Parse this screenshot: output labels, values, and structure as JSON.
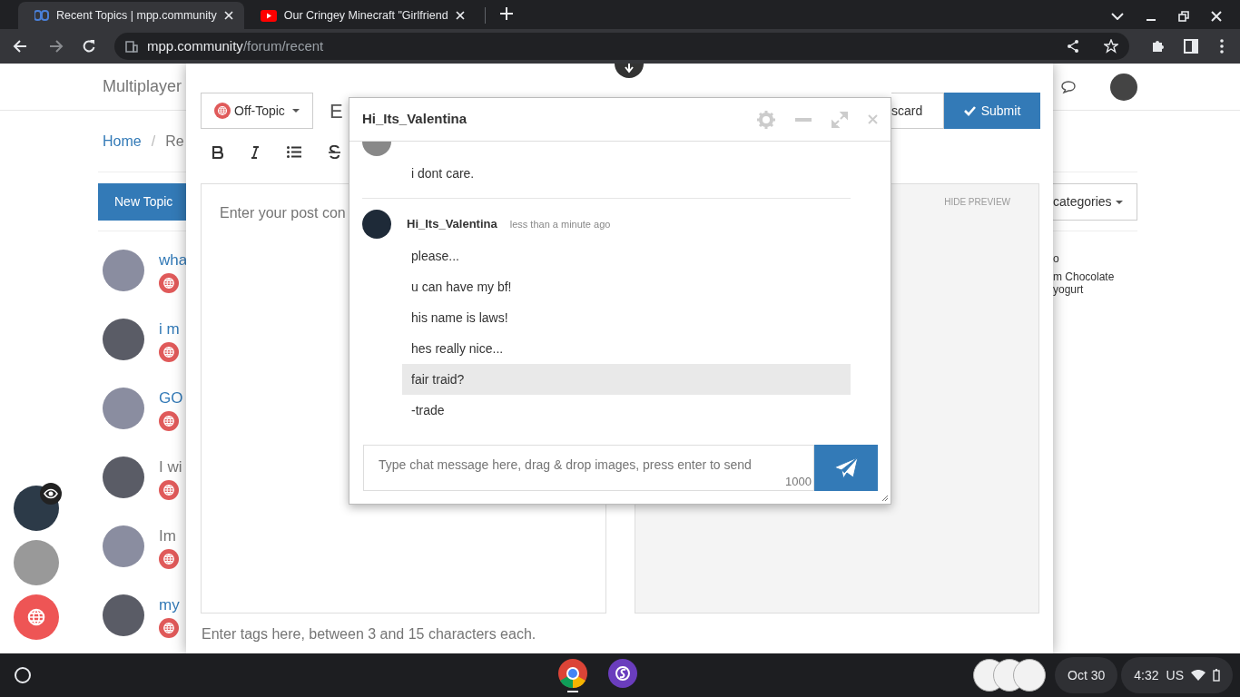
{
  "browser": {
    "tabs": [
      {
        "title": "Recent Topics | mpp.community",
        "selected": true,
        "kind": "forum"
      },
      {
        "title": "Our Cringey Minecraft \"Girlfriend",
        "selected": false,
        "kind": "video"
      }
    ],
    "address": {
      "host": "mpp.community",
      "path": "/forum/recent"
    }
  },
  "forum": {
    "brand": "Multiplayer",
    "breadcrumb": [
      "Home",
      "Re"
    ],
    "breadcrumb_separator": "/",
    "new_topic": "New Topic",
    "categories_button": "categories",
    "topics": [
      {
        "title": "wha",
        "read": false
      },
      {
        "title": "i m",
        "read": false
      },
      {
        "title": "GO",
        "read": false
      },
      {
        "title": "I wi",
        "read": true
      },
      {
        "title": "Im",
        "read": true
      },
      {
        "title": "my",
        "read": false
      }
    ],
    "sidebar": {
      "link": "o",
      "lines": [
        "m Chocolate",
        "yogurt"
      ]
    }
  },
  "composer": {
    "category": "Off-Topic",
    "title_value": "E",
    "discard": "scard",
    "submit": "Submit",
    "content_placeholder": "Enter your post con",
    "hide_preview": "HIDE PREVIEW",
    "tags_placeholder": "Enter tags here, between 3 and 15 characters each."
  },
  "chat": {
    "title": "Hi_Its_Valentina",
    "groups": [
      {
        "messages": [
          {
            "text": "i dont care.",
            "highlighted": false
          }
        ]
      },
      {
        "author": "Hi_Its_Valentina",
        "time": "less than a minute ago",
        "messages": [
          {
            "text": "please...",
            "highlighted": false
          },
          {
            "text": "u can have my bf!",
            "highlighted": false
          },
          {
            "text": "his name is laws!",
            "highlighted": false
          },
          {
            "text": "hes really nice...",
            "highlighted": false
          },
          {
            "text": "fair traid?",
            "highlighted": true
          },
          {
            "text": "-trade",
            "highlighted": false
          }
        ]
      }
    ],
    "input": {
      "placeholder": "Type chat message here, drag & drop images, press enter to send",
      "counter": "1000"
    }
  },
  "taskbar": {
    "date": "Oct 30",
    "time": "4:32",
    "locale": "US"
  }
}
